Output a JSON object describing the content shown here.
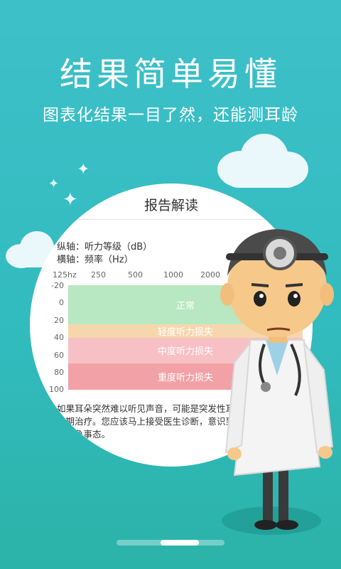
{
  "headline": "结果简单易懂",
  "subline": "图表化结果一目了然，还能测耳龄",
  "report": {
    "title": "报告解读",
    "y_axis_note": "纵轴：听力等级（dB）",
    "x_axis_note": "横轴：频率（Hz）",
    "freq_labels": [
      "125hz",
      "250",
      "500",
      "1000",
      "2000"
    ],
    "db_labels": [
      "-20",
      "0",
      "20",
      "40",
      "60",
      "80",
      "100"
    ],
    "bands": [
      {
        "label": "正常",
        "from_db": -20,
        "to_db": 25,
        "color": "#b7e8c1"
      },
      {
        "label": "轻度听力损失",
        "from_db": 25,
        "to_db": 40,
        "color": "#f6d7ad"
      },
      {
        "label": "中度听力损失",
        "from_db": 40,
        "to_db": 70,
        "color": "#f7c0c4"
      },
      {
        "label": "重度听力损失",
        "from_db": 70,
        "to_db": 100,
        "color": "#f2a2a6"
      }
    ],
    "paragraph": "如果耳朵突然难以听见声音，可能是突发性耳聋，最重要的是早期治疗。您应该马上接受医生诊断，意识到这是一种医学上的紧急事态。"
  },
  "pager": {
    "pages": 3,
    "active": 2
  },
  "colors": {
    "bg_top": "#3ec0c9",
    "bg_bottom": "#2bb3a9"
  }
}
